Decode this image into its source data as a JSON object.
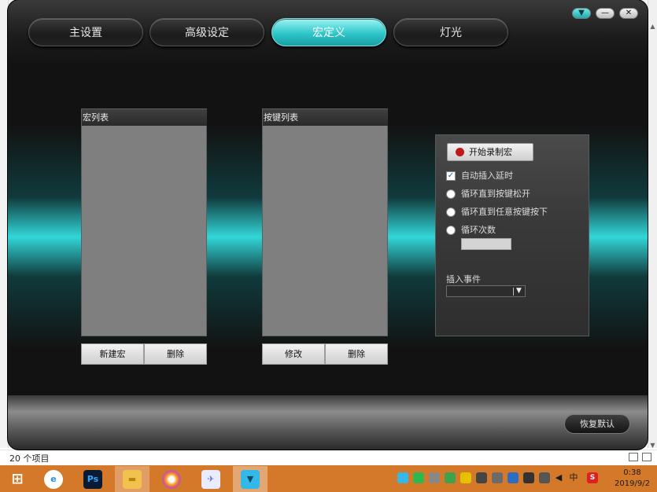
{
  "tabs": [
    {
      "label": "主设置",
      "active": false
    },
    {
      "label": "高级设定",
      "active": false
    },
    {
      "label": "宏定义",
      "active": true
    },
    {
      "label": "灯光",
      "active": false
    }
  ],
  "window_controls": {
    "menu": "▼",
    "minimize": "—",
    "close": "✕"
  },
  "macro_list": {
    "header": "宏列表",
    "new_label": "新建宏",
    "delete_label": "删除"
  },
  "key_list": {
    "header": "按键列表",
    "modify_label": "修改",
    "delete_label": "删除"
  },
  "macro_options": {
    "record_label": "开始录制宏",
    "auto_delay_label": "自动插入延时",
    "auto_delay_checked": true,
    "loop_until_release_label": "循环直到按键松开",
    "loop_until_any_key_label": "循环直到任意按键按下",
    "loop_count_label": "循环次数",
    "loop_count_value": "",
    "insert_event_label": "插入事件",
    "insert_event_value": ""
  },
  "restore_defaults_label": "恢复默认",
  "explorer": {
    "status_text": "20 个项目"
  },
  "taskbar": {
    "apps": [
      {
        "name": "windows-start",
        "glyph": "⊞",
        "color": "#ffffff"
      },
      {
        "name": "browser",
        "glyph": "e",
        "color": "#2a8fe0"
      },
      {
        "name": "photoshop",
        "glyph": "Ps",
        "color": "#31a8ff"
      },
      {
        "name": "file-explorer",
        "glyph": "▬",
        "color": "#f2c14e"
      },
      {
        "name": "color-wheel",
        "glyph": "●",
        "color": "#e84f7a"
      },
      {
        "name": "bird-app",
        "glyph": "✈",
        "color": "#5b74d6"
      },
      {
        "name": "active-app",
        "glyph": "▼",
        "color": "#33b8e8"
      }
    ],
    "tray_ime": "中",
    "tray_s": "S",
    "time": "0:38",
    "date": "2019/9/2"
  },
  "colors": {
    "accent": "#2ec6c9",
    "record_dot": "#c0191b",
    "taskbar": "#d4792a"
  }
}
